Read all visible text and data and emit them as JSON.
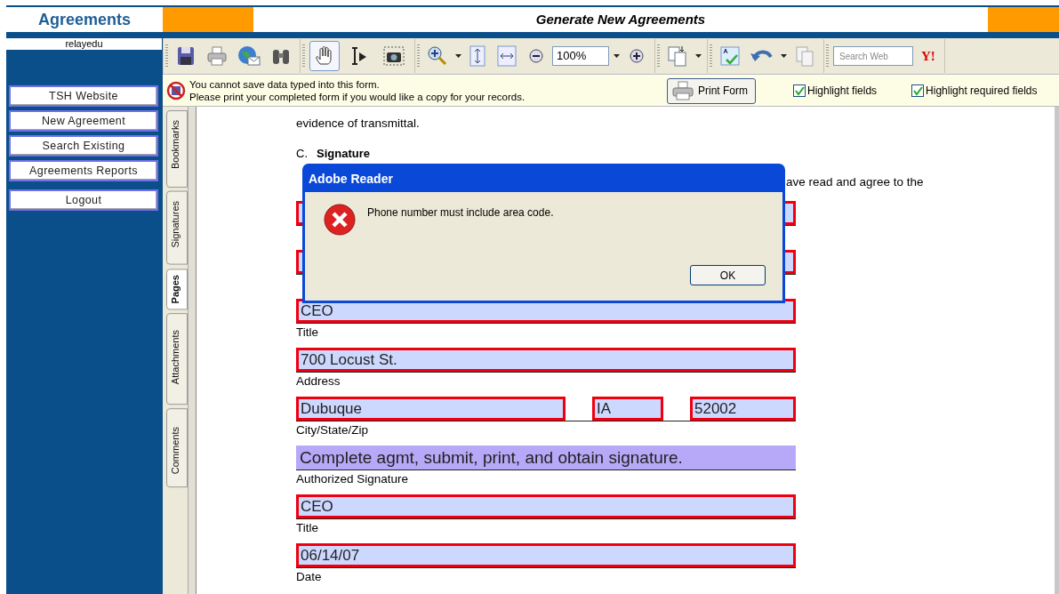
{
  "app": {
    "title": "Agreements",
    "user": "relayedu",
    "page_title": "Generate New Agreements"
  },
  "nav": [
    {
      "label": "TSH Website"
    },
    {
      "label": "New Agreement"
    },
    {
      "label": "Search Existing"
    },
    {
      "label": "Agreements Reports"
    },
    {
      "label": "Logout"
    }
  ],
  "tools": [
    {
      "selected": true
    },
    {
      "selected": false
    },
    {
      "selected": false
    }
  ],
  "zoom": "100%",
  "search": {
    "placeholder": "Search Web"
  },
  "search_logo": "Y!",
  "notice": {
    "lines": [
      "You cannot save data typed into this form.",
      "Please print your completed form if you would like a copy for your records."
    ],
    "button": "Print Form",
    "checkboxes": [
      {
        "label": "Highlight fields",
        "checked": true
      },
      {
        "label": "Highlight required fields",
        "checked": true
      }
    ]
  },
  "side_tabs": [
    {
      "label": "Bookmarks",
      "selected": false
    },
    {
      "label": "Signatures",
      "selected": false
    },
    {
      "label": "Pages",
      "selected": true
    },
    {
      "label": "Attachments",
      "selected": false
    },
    {
      "label": "Comments",
      "selected": false
    }
  ],
  "document": {
    "intro": "evidence of transmittal.",
    "section_letter": "C.",
    "section_title": "Signature",
    "partial_text": "ave read and agree to the",
    "rows": [
      {
        "fields": [
          {
            "required": true
          }
        ]
      },
      {
        "fields": [
          {
            "required": true
          }
        ]
      },
      {
        "fields": [
          {
            "value": "CEO",
            "required": true
          }
        ],
        "label": "Title"
      },
      {
        "fields": [
          {
            "value": "700 Locust St.",
            "required": true
          }
        ],
        "label": "Address"
      },
      {
        "fields": [
          {
            "value": "Dubuque",
            "required": true
          },
          {
            "value": "IA",
            "required": true
          },
          {
            "value": "52002",
            "required": true
          }
        ],
        "label": "City/State/Zip"
      },
      {
        "fields": [
          {
            "value": "Complete agmt, submit, print, and obtain signature.",
            "required": false
          }
        ],
        "label": "Authorized Signature"
      },
      {
        "fields": [
          {
            "value": "CEO",
            "required": true
          }
        ],
        "label": "Title"
      },
      {
        "fields": [
          {
            "value": "06/14/07",
            "required": true
          }
        ],
        "label": "Date"
      }
    ]
  },
  "dialog": {
    "title": "Adobe Reader",
    "message": "Phone number must include area code.",
    "button": "OK"
  }
}
